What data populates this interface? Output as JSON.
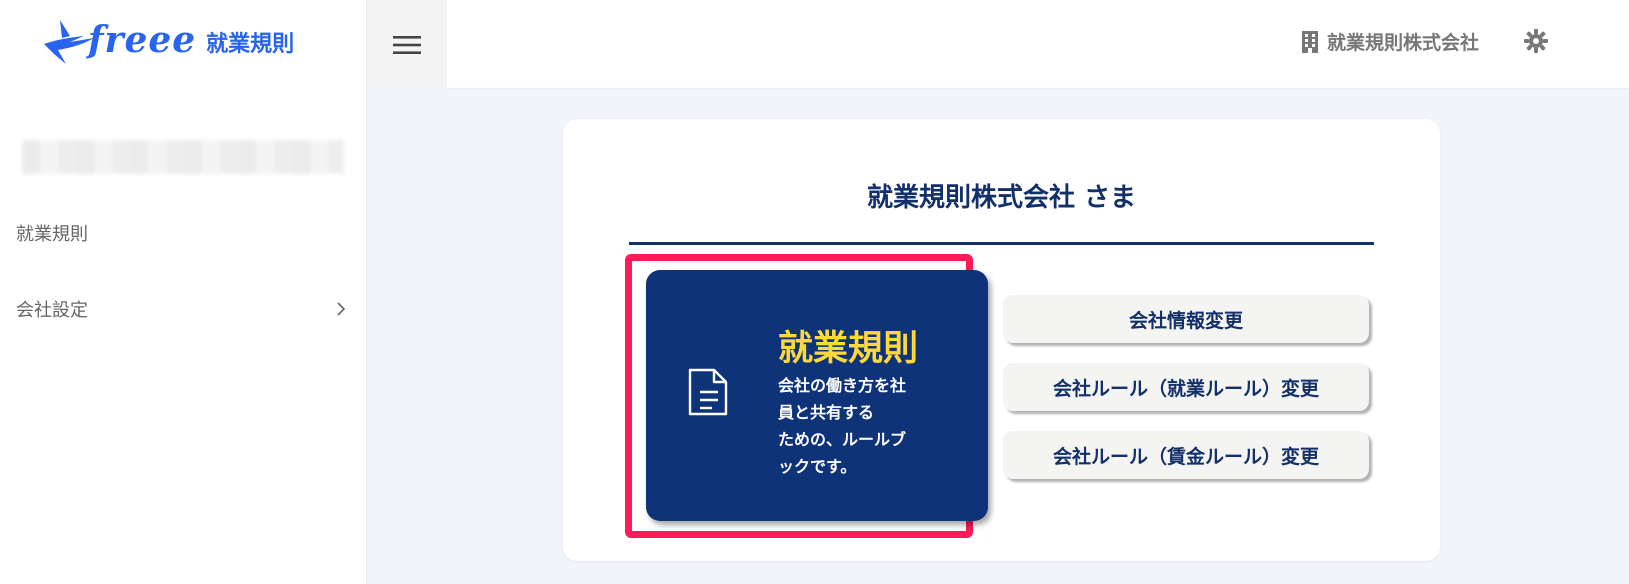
{
  "app": {
    "logo_word": "freee",
    "product_name": "就業規則"
  },
  "sidebar": {
    "items": [
      {
        "label": "就業規則"
      },
      {
        "label": "会社設定"
      }
    ]
  },
  "header": {
    "company_name": "就業規則株式会社"
  },
  "main": {
    "greeting": "就業規則株式会社 さま",
    "feature": {
      "title": "就業規則",
      "description_lines": [
        "会社の働き方を社",
        "員と共有する",
        "ための、ルールブ",
        "ックです。"
      ]
    },
    "actions": [
      {
        "label": "会社情報変更"
      },
      {
        "label": "会社ルール（就業ルール）変更"
      },
      {
        "label": "会社ルール（賃金ルール）変更"
      }
    ]
  },
  "colors": {
    "brand": "#2864f0",
    "navy": "#0e3378",
    "highlight": "#ff1a5a",
    "title_yellow": "#ffd93b"
  }
}
